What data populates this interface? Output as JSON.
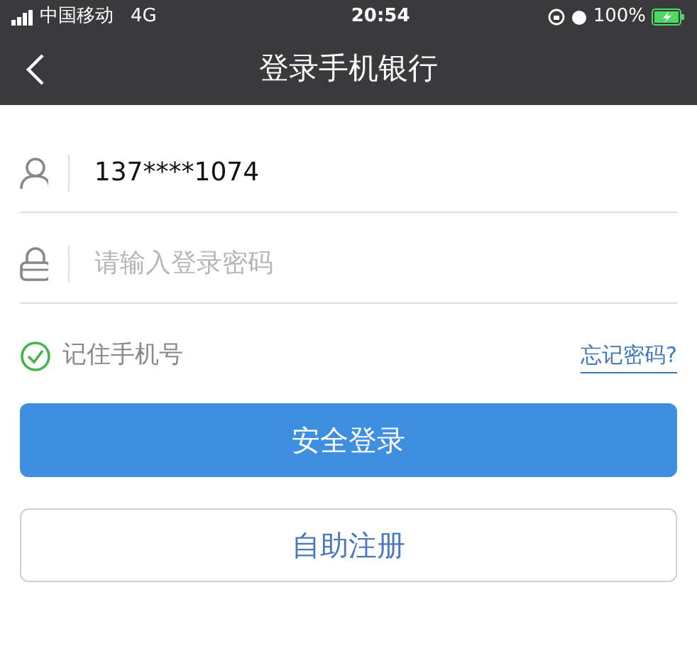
{
  "status_bar": {
    "carrier": "中国移动",
    "network": "4G",
    "time": "20:54",
    "battery": "100%"
  },
  "header": {
    "title": "登录手机银行"
  },
  "fields": [
    {
      "kind": "user",
      "value": "137****1074"
    },
    {
      "kind": "lock",
      "placeholder": "请输入登录密码"
    }
  ],
  "remember": {
    "label": "记住手机号",
    "checked": true
  },
  "forgot_link": "忘记密码?",
  "buttons": [
    {
      "kind": "primary",
      "label": "安全登录"
    },
    {
      "kind": "outline",
      "label": "自助注册"
    }
  ]
}
